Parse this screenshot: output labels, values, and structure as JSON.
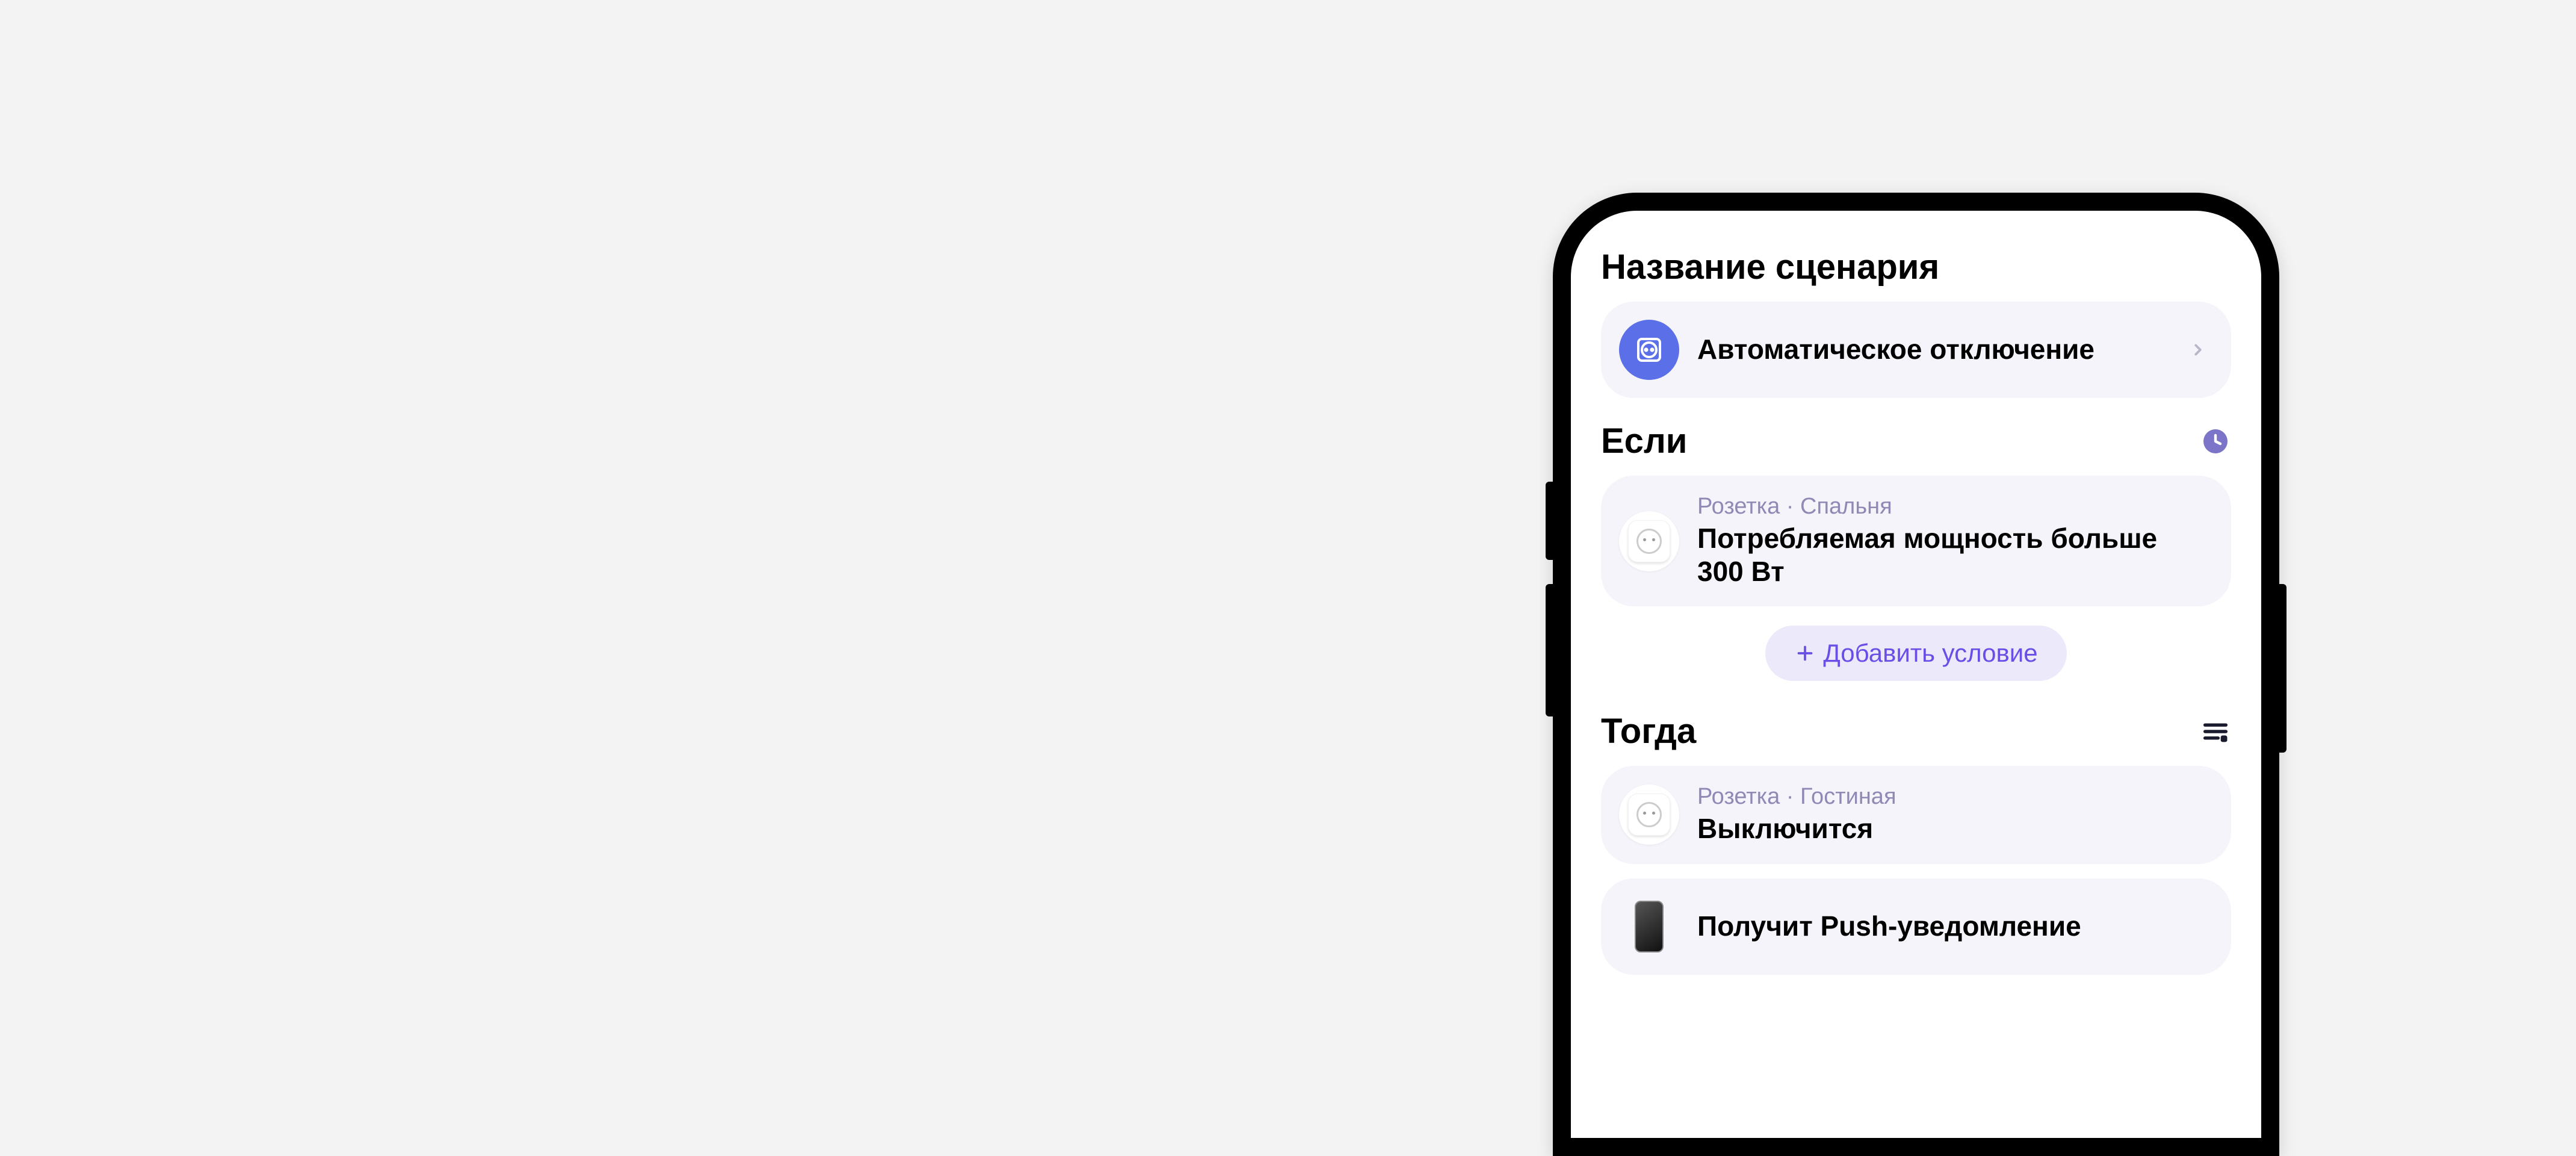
{
  "name_section": {
    "heading": "Название сценария",
    "scenario_name": "Автоматическое отключение"
  },
  "if_section": {
    "heading": "Если",
    "condition": {
      "meta": "Розетка · Спальня",
      "text": "Потребляемая мощность больше 300 Вт"
    },
    "add_button": "Добавить условие"
  },
  "then_section": {
    "heading": "Тогда",
    "actions": [
      {
        "meta": "Розетка · Гостиная",
        "text": "Выключится"
      },
      {
        "text": "Получит Push-уведомление"
      }
    ]
  }
}
